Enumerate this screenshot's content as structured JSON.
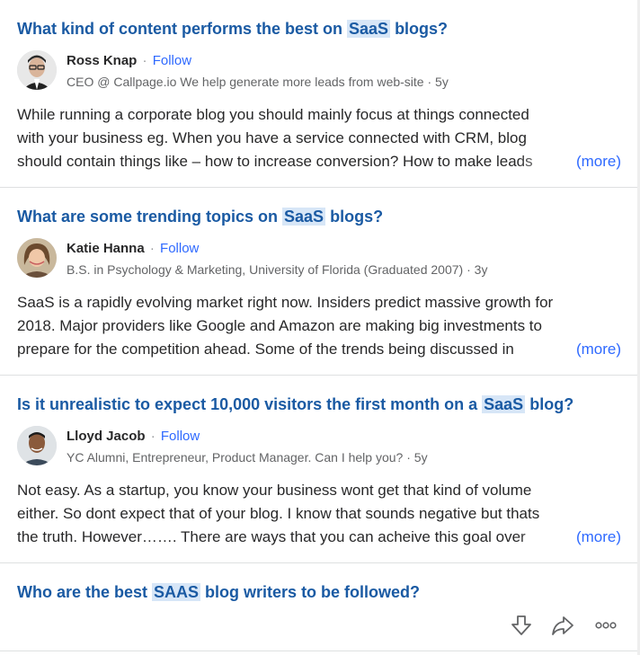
{
  "feed": [
    {
      "question": {
        "before": "What kind of content performs the best on ",
        "highlight": "SaaS",
        "after": " blogs?"
      },
      "author": {
        "name": "Ross Knap",
        "follow": "Follow",
        "credential": "CEO @ Callpage.io We help generate more leads from web-site",
        "age": "5y"
      },
      "snippet": [
        "While running a corporate blog you should mainly focus at things connected",
        "with your business eg. When you have a service connected with CRM, blog",
        "should contain things like – how to increase conversion? How to make leads"
      ],
      "more": "(more)"
    },
    {
      "question": {
        "before": "What are some trending topics on ",
        "highlight": "SaaS",
        "after": " blogs?"
      },
      "author": {
        "name": "Katie Hanna",
        "follow": "Follow",
        "credential": "B.S. in Psychology & Marketing, University of Florida (Graduated 2007)",
        "age": "3y"
      },
      "snippet": [
        "SaaS is a rapidly evolving market right now. Insiders predict massive growth for",
        "2018. Major providers like Google and Amazon are making big investments to",
        "prepare for the competition ahead. Some of the trends being discussed in"
      ],
      "more": "(more)"
    },
    {
      "question": {
        "before": "Is it unrealistic to expect 10,000 visitors the first month on a ",
        "highlight": "SaaS",
        "after": " blog?"
      },
      "author": {
        "name": "Lloyd Jacob",
        "follow": "Follow",
        "credential": "YC Alumni, Entrepreneur, Product Manager. Can I help you?",
        "age": "5y"
      },
      "snippet": [
        "Not easy. As a startup, you know your business wont get that kind of volume",
        "either. So dont expect that of your blog. I know that sounds negative but thats",
        "the truth. However……. There are ways that you can acheive this goal over"
      ],
      "more": "(more)"
    }
  ],
  "last_question": {
    "before": "Who are the best ",
    "highlight": "SAAS",
    "after": " blog writers to be followed?"
  },
  "icons": {
    "downvote": "downvote-arrow-icon",
    "share": "share-arrow-icon",
    "more": "more-dots-icon"
  },
  "colors": {
    "question": "#1a5aa3",
    "link": "#2e69ff",
    "highlight": "#d7e6f7",
    "text": "#282829",
    "muted": "#636466",
    "divider": "#dee0e1"
  }
}
